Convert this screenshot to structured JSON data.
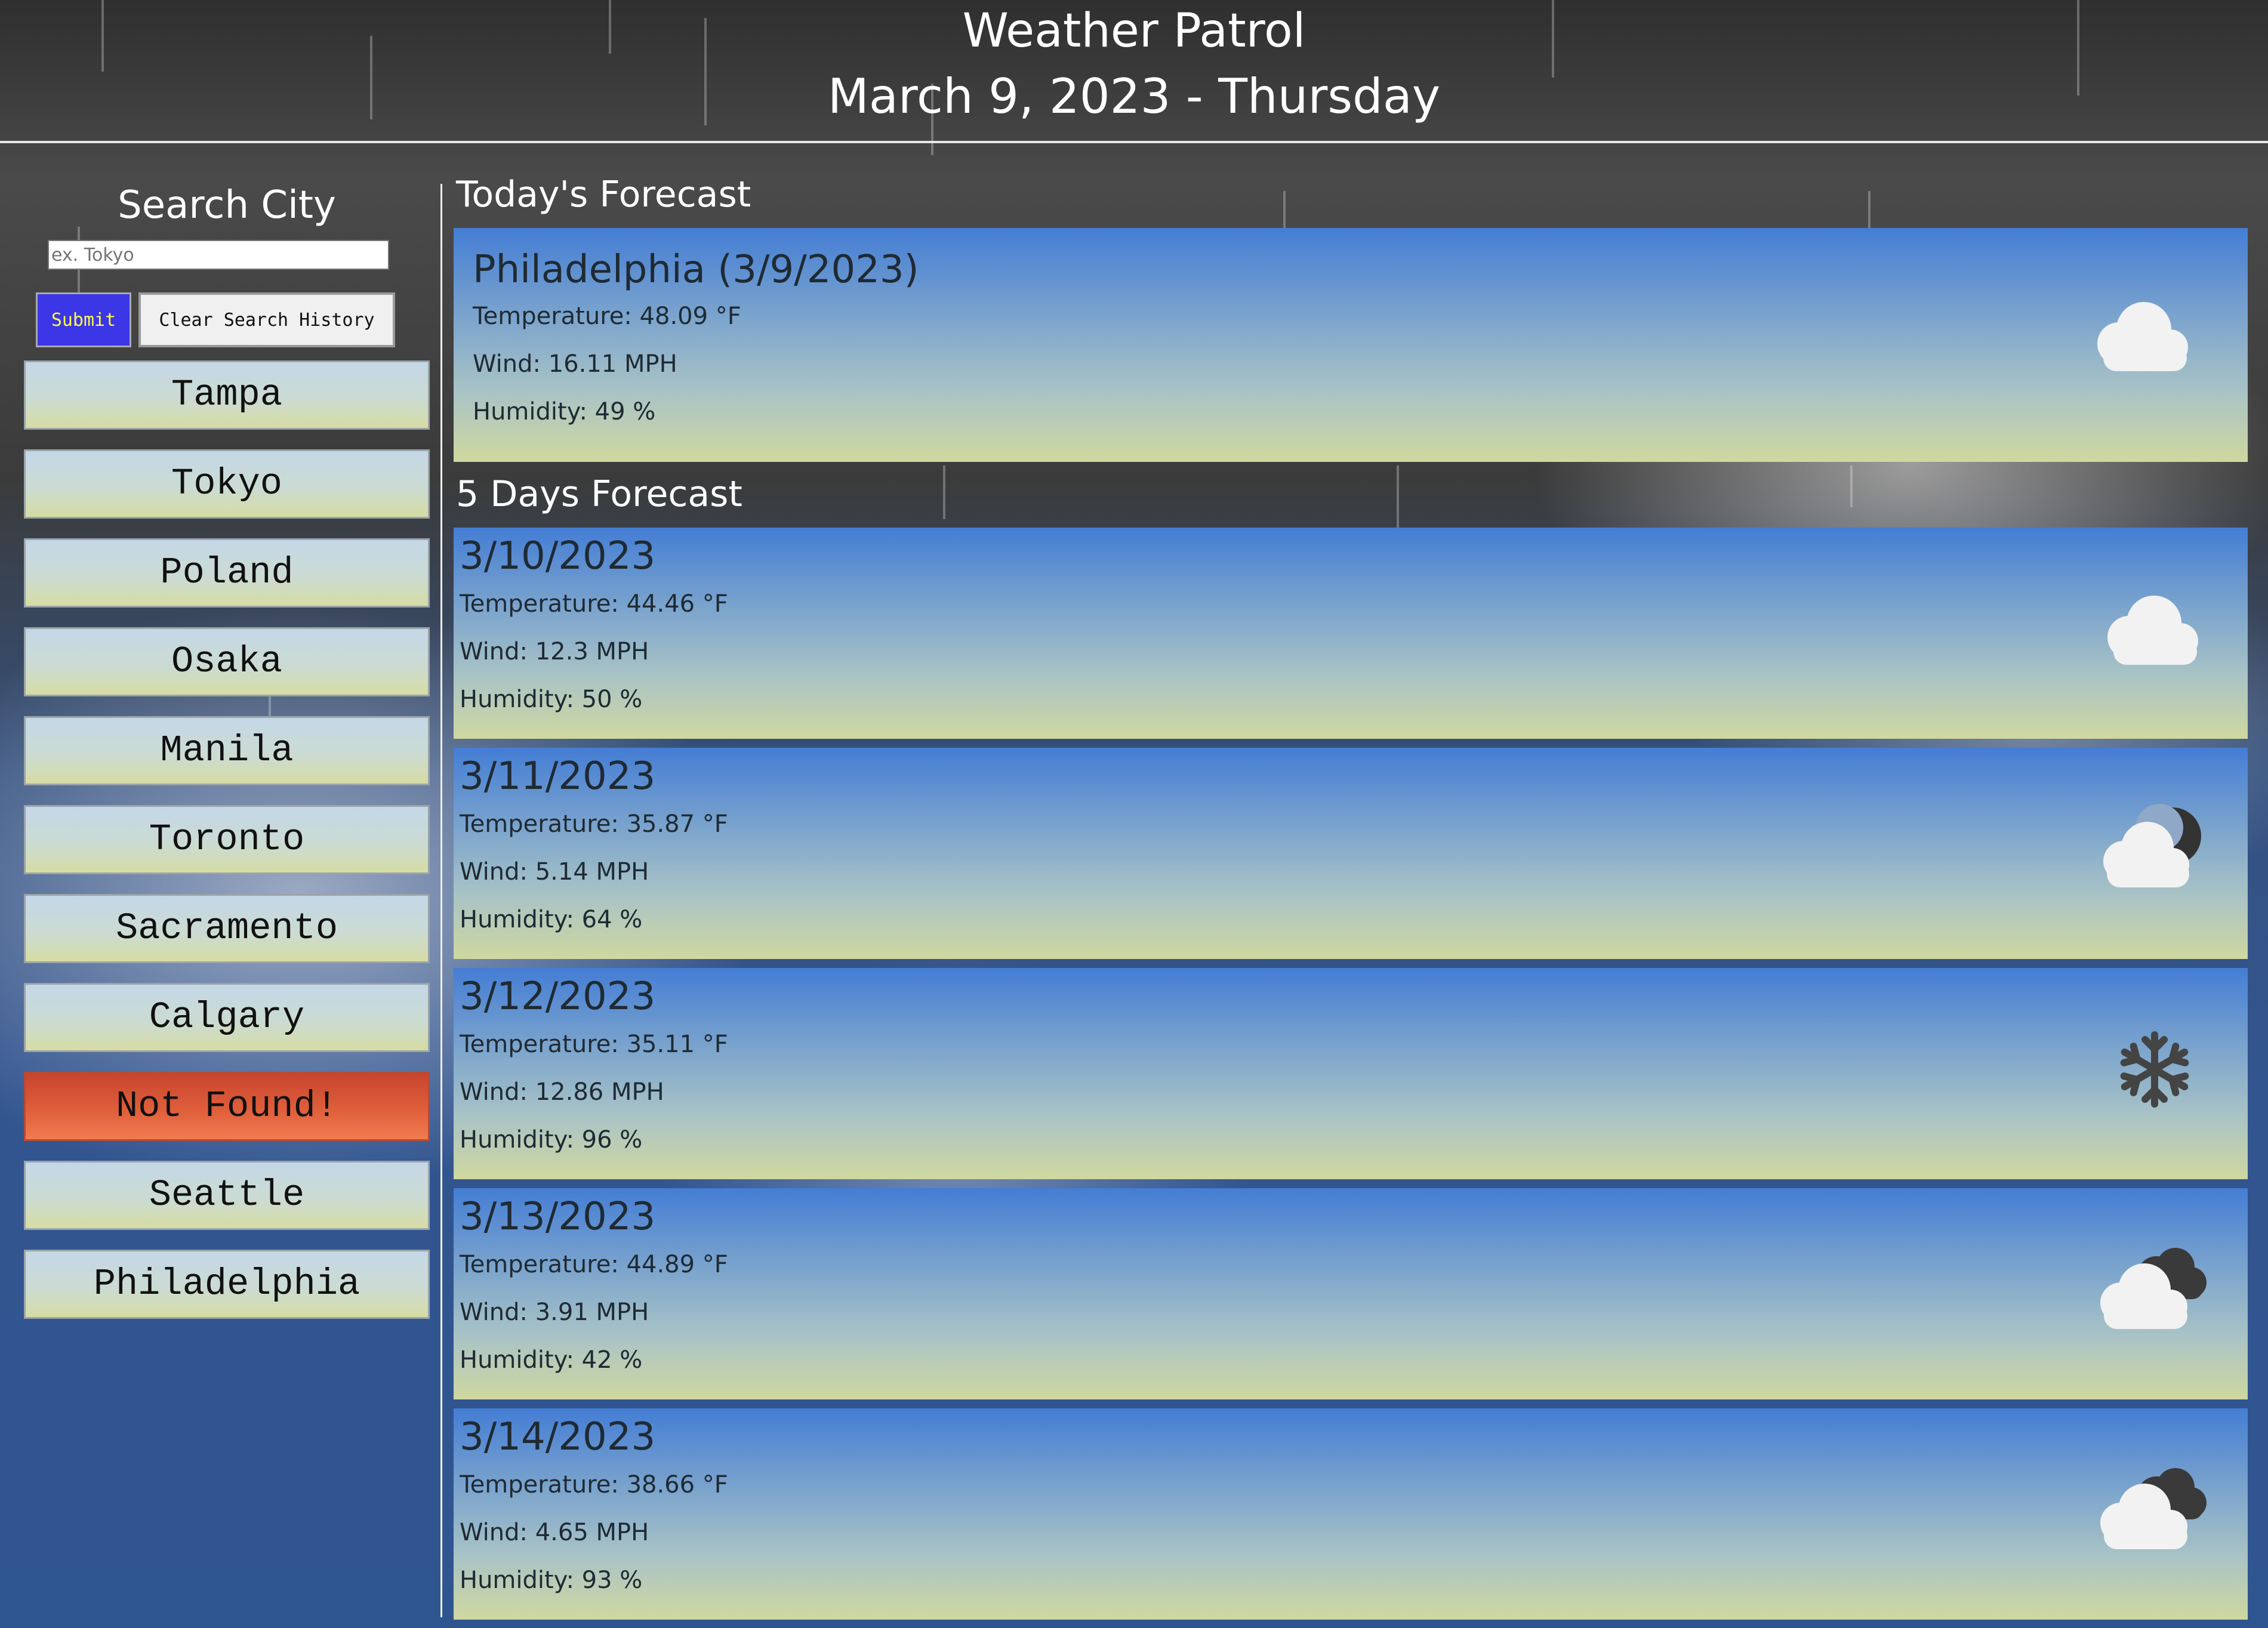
{
  "header": {
    "title": "Weather Patrol",
    "date": "March 9, 2023 - Thursday"
  },
  "sidebar": {
    "search_title": "Search City",
    "search_placeholder": "ex. Tokyo",
    "submit_label": "Submit",
    "clear_label": "Clear Search History",
    "history": [
      "Tampa",
      "Tokyo",
      "Poland",
      "Osaka",
      "Manila",
      "Toronto",
      "Sacramento",
      "Calgary",
      "Not Found!",
      "Seattle",
      "Philadelphia"
    ]
  },
  "today": {
    "section_title": "Today's Forecast",
    "title": "Philadelphia (3/9/2023)",
    "temperature": "Temperature: 48.09 °F",
    "wind": "Wind: 16.11 MPH",
    "humidity": "Humidity: 49 %",
    "icon": "cloud-icon"
  },
  "forecast": {
    "section_title": "5 Days Forecast",
    "days": [
      {
        "date": "3/10/2023",
        "temperature": "Temperature: 44.46 °F",
        "wind": "Wind: 12.3 MPH",
        "humidity": "Humidity: 50 %",
        "icon": "cloud-icon"
      },
      {
        "date": "3/11/2023",
        "temperature": "Temperature: 35.87 °F",
        "wind": "Wind: 5.14 MPH",
        "humidity": "Humidity: 64 %",
        "icon": "partly-cloudy-night-icon"
      },
      {
        "date": "3/12/2023",
        "temperature": "Temperature: 35.11 °F",
        "wind": "Wind: 12.86 MPH",
        "humidity": "Humidity: 96 %",
        "icon": "snowflake-icon"
      },
      {
        "date": "3/13/2023",
        "temperature": "Temperature: 44.89 °F",
        "wind": "Wind: 3.91 MPH",
        "humidity": "Humidity: 42 %",
        "icon": "broken-clouds-icon"
      },
      {
        "date": "3/14/2023",
        "temperature": "Temperature: 38.66 °F",
        "wind": "Wind: 4.65 MPH",
        "humidity": "Humidity: 93 %",
        "icon": "broken-clouds-icon"
      }
    ]
  }
}
